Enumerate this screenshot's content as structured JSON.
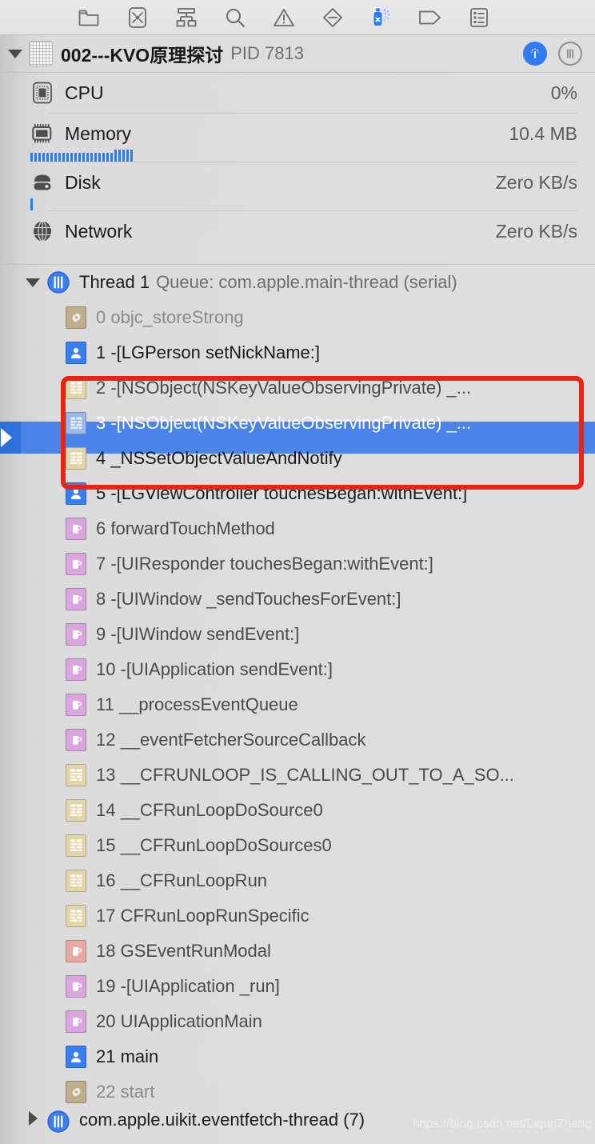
{
  "toolbar": {
    "buttons": [
      {
        "name": "folder-icon",
        "label": "Show only stack frames with debug symbols"
      },
      {
        "name": "crash-icon",
        "label": "Show only crashed threads"
      },
      {
        "name": "hierarchy-icon",
        "label": "View Process Hierarchy"
      },
      {
        "name": "search-icon",
        "label": "Filter"
      },
      {
        "name": "warning-icon",
        "label": "Runtime issues"
      },
      {
        "name": "memory-diamond-icon",
        "label": "Memory graph"
      },
      {
        "name": "spray-can-icon",
        "label": "Debug Memory Graph"
      },
      {
        "name": "tag-icon",
        "label": "Tag"
      },
      {
        "name": "list-icon",
        "label": "Show debug navigator list"
      }
    ]
  },
  "process": {
    "title": "002---KVO原理探讨",
    "pid": "PID 7813",
    "disclosure": "expanded",
    "right_buttons": [
      "info-icon",
      "pause-icon"
    ]
  },
  "gauges": [
    {
      "icon": "cpu-icon",
      "label": "CPU",
      "value": "0%",
      "bars": 0
    },
    {
      "icon": "memory-icon",
      "label": "Memory",
      "value": "10.4 MB",
      "bars": 26
    },
    {
      "icon": "disk-icon",
      "label": "Disk",
      "value": "Zero KB/s",
      "bars": 1
    },
    {
      "icon": "network-icon",
      "label": "Network",
      "value": "Zero KB/s",
      "bars": 0
    }
  ],
  "thread": {
    "name": "Thread 1",
    "queue": "Queue: com.apple.main-thread (serial)",
    "disclosure": "expanded"
  },
  "frames": [
    {
      "num": "0",
      "text": "objc_storeStrong",
      "icon": "gear-icon",
      "style": "dim",
      "selected": false
    },
    {
      "num": "1",
      "text": "-[LGPerson setNickName:]",
      "icon": "user-icon",
      "style": "app",
      "selected": false
    },
    {
      "num": "2",
      "text": "-[NSObject(NSKeyValueObservingPrivate) _...",
      "icon": "cf-icon",
      "style": "",
      "selected": false
    },
    {
      "num": "3",
      "text": "-[NSObject(NSKeyValueObservingPrivate) _...",
      "icon": "cf-icon",
      "style": "",
      "selected": true
    },
    {
      "num": "4",
      "text": "_NSSetObjectValueAndNotify",
      "icon": "cf-icon",
      "style": "app",
      "selected": false
    },
    {
      "num": "5",
      "text": "-[LGViewController touchesBegan:withEvent:]",
      "icon": "user-icon",
      "style": "app",
      "selected": false
    },
    {
      "num": "6",
      "text": "forwardTouchMethod",
      "icon": "uikit-icon",
      "style": "",
      "selected": false
    },
    {
      "num": "7",
      "text": "-[UIResponder touchesBegan:withEvent:]",
      "icon": "uikit-icon",
      "style": "",
      "selected": false
    },
    {
      "num": "8",
      "text": "-[UIWindow _sendTouchesForEvent:]",
      "icon": "uikit-icon",
      "style": "",
      "selected": false
    },
    {
      "num": "9",
      "text": "-[UIWindow sendEvent:]",
      "icon": "uikit-icon",
      "style": "",
      "selected": false
    },
    {
      "num": "10",
      "text": "-[UIApplication sendEvent:]",
      "icon": "uikit-icon",
      "style": "",
      "selected": false
    },
    {
      "num": "11",
      "text": "__processEventQueue",
      "icon": "uikit-icon",
      "style": "",
      "selected": false
    },
    {
      "num": "12",
      "text": "__eventFetcherSourceCallback",
      "icon": "uikit-icon",
      "style": "",
      "selected": false
    },
    {
      "num": "13",
      "text": "__CFRUNLOOP_IS_CALLING_OUT_TO_A_SO...",
      "icon": "cf-icon",
      "style": "",
      "selected": false
    },
    {
      "num": "14",
      "text": "__CFRunLoopDoSource0",
      "icon": "cf-icon",
      "style": "",
      "selected": false
    },
    {
      "num": "15",
      "text": "__CFRunLoopDoSources0",
      "icon": "cf-icon",
      "style": "",
      "selected": false
    },
    {
      "num": "16",
      "text": "__CFRunLoopRun",
      "icon": "cf-icon",
      "style": "",
      "selected": false
    },
    {
      "num": "17",
      "text": "CFRunLoopRunSpecific",
      "icon": "cf-icon",
      "style": "",
      "selected": false
    },
    {
      "num": "18",
      "text": "GSEventRunModal",
      "icon": "gs-icon",
      "style": "",
      "selected": false
    },
    {
      "num": "19",
      "text": "-[UIApplication _run]",
      "icon": "uikit-icon",
      "style": "",
      "selected": false
    },
    {
      "num": "20",
      "text": "UIApplicationMain",
      "icon": "uikit-icon",
      "style": "",
      "selected": false
    },
    {
      "num": "21",
      "text": "main",
      "icon": "user-icon",
      "style": "app",
      "selected": false
    },
    {
      "num": "22",
      "text": "start",
      "icon": "gear-icon",
      "style": "dim",
      "selected": false
    }
  ],
  "bottom_thread": {
    "name": "com.apple.uikit.eventfetch-thread (7)",
    "disclosure": "collapsed"
  },
  "annotation": {
    "shape": "rounded-rectangle",
    "color": "#ea2415",
    "covers_frames": [
      "2",
      "3",
      "4"
    ]
  },
  "watermark": "https://blog.csdn.net/LiqunZhang",
  "colors": {
    "selection": "#4a84e8",
    "accent_blue": "#2a7bf0",
    "annotation_red": "#ea2415",
    "panel_bg": "#dedede"
  }
}
